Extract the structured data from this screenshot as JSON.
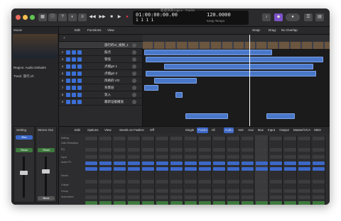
{
  "window": {
    "title": "新建项目.logicx - Tracks"
  },
  "lcd": {
    "timecode": "01:00:00:00.00",
    "bars": "1   1   1   1",
    "tempo": "120.0000",
    "keep": "Keep Tempo"
  },
  "toolbar": {
    "edit": "Edit",
    "functions": "Functions",
    "view": "View",
    "drag": "Drag:",
    "overlap": "No Overlap",
    "snap": "Snap:"
  },
  "inspector": {
    "movie": "Movie",
    "region": "Region: Audio Defaults",
    "track": "Track: 旅行,ch",
    "setting": "Setting",
    "stereo_out": "Stereo Out",
    "ch_a": "Read",
    "ch_b": "Read",
    "bounce": "Bnce"
  },
  "tracks": [
    {
      "n": "1",
      "name": "旅行的Vi_视频_1"
    },
    {
      "n": "2",
      "name": "鼓点"
    },
    {
      "n": "3",
      "name": "管弦"
    },
    {
      "n": "4",
      "name": "点缀gtr 1"
    },
    {
      "n": "5",
      "name": "点缀gtr 2"
    },
    {
      "n": "6",
      "name": "风格的 VO"
    },
    {
      "n": "7",
      "name": "背景层"
    },
    {
      "n": "8",
      "name": "氛入"
    },
    {
      "n": "9",
      "name": "最新证据播放"
    }
  ],
  "mixer": {
    "edit": "Edit",
    "options": "Options",
    "view": "View",
    "sends": "Sends on Faders:",
    "off": "Off",
    "single": "Single",
    "tracks": "Tracks",
    "all": "All",
    "tabs": [
      "Audio",
      "Inst",
      "Aux",
      "Bus",
      "Input",
      "Output",
      "Master/VCA",
      "MIDI"
    ],
    "labels": [
      "Setting",
      "Gain Reduction",
      "EQ",
      "Input",
      "Audio FX",
      "Sends",
      "Output",
      "Group",
      "Automation"
    ]
  },
  "colors": {
    "accent": "#3b6fd6",
    "region": "#4a78c9",
    "selected": "#5a87d8"
  }
}
